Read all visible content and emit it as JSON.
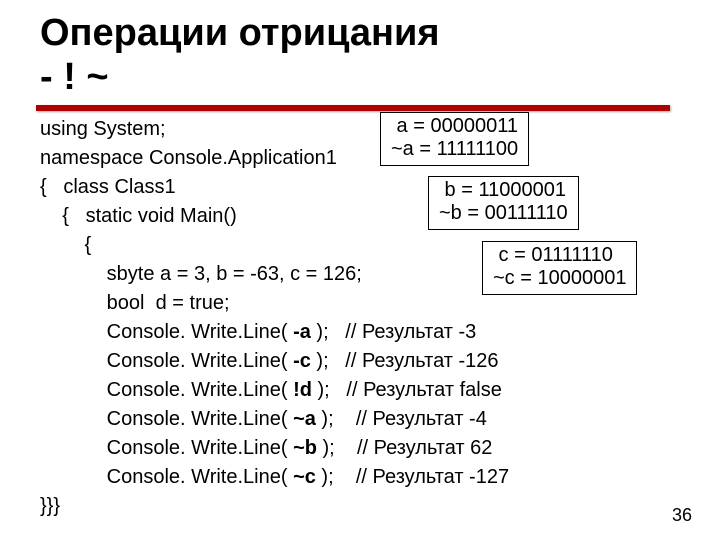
{
  "title_line1": "Операции отрицания",
  "title_line2": "- ! ~",
  "code": {
    "l01": "using System;",
    "l02": "namespace Console.Application1",
    "l03": "{   class Class1",
    "l04": "    {   static void Main()",
    "l05": "        {",
    "l06": "            sbyte a = 3, b = -63, c = 126;",
    "l07": "            bool  d = true;",
    "l08a": "            Console. Write.Line( ",
    "l08b": "-a",
    "l08c": " );   // Результат -3",
    "l09a": "            Console. Write.Line( ",
    "l09b": "-c",
    "l09c": " );   // Результат -126",
    "l10a": "            Console. Write.Line( ",
    "l10b": "!d",
    "l10c": " );   // Результат false",
    "l11a": "            Console. Write.Line( ",
    "l11b": "~a",
    "l11c": " );    // Результат -4",
    "l12a": "            Console. Write.Line( ",
    "l12b": "~b",
    "l12c": " );    // Результат 62",
    "l13a": "            Console. Write.Line( ",
    "l13b": "~c",
    "l13c": " );    // Результат -127",
    "l14": "}}}"
  },
  "box_a": " a = 00000011\n~a = 11111100",
  "box_b": " b = 11000001\n~b = 00111110",
  "box_c": " c = 01111110\n~c = 10000001",
  "page_number": "36"
}
